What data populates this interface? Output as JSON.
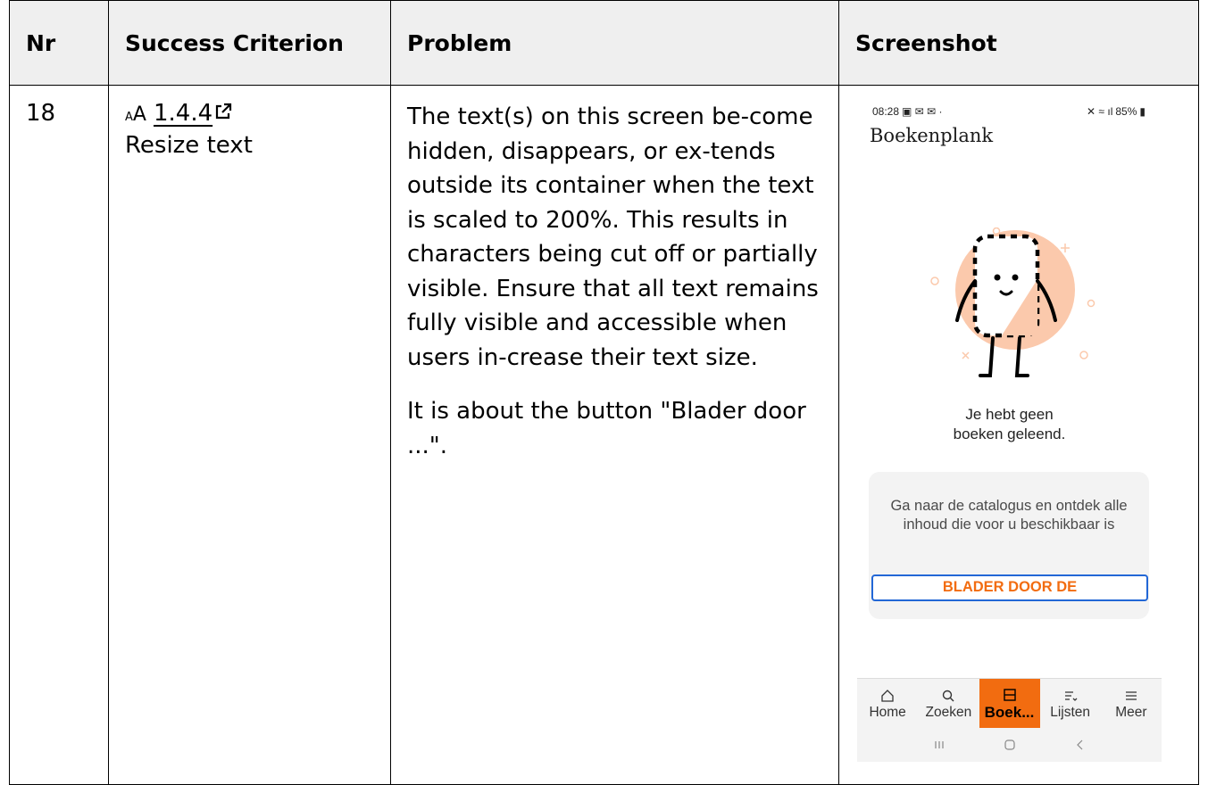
{
  "table": {
    "headers": {
      "nr": "Nr",
      "criterion": "Success Criterion",
      "problem": "Problem",
      "screenshot": "Screenshot"
    },
    "row": {
      "nr": "18",
      "criterion_code": "1.4.4",
      "criterion_name": "Resize text",
      "problem_paragraphs": [
        "The text(s) on this screen be-come hidden, disappears, or ex-tends outside its container when the text is scaled to 200%. This results in characters being cut off or partially visible. Ensure that all text remains fully visible and accessible when users in-crease their text size.",
        "It is about the button \"Blader door ...\"."
      ]
    }
  },
  "screenshot": {
    "status_time": "08:28",
    "status_battery": "85%",
    "app_title": "Boekenplank",
    "empty_line1": "Je hebt geen",
    "empty_line2": "boeken geleend.",
    "card_text": "Ga naar de catalogus en ontdek alle inhoud die voor u beschikbaar is",
    "card_button": "BLADER DOOR DE",
    "nav": [
      {
        "label": "Home",
        "icon": "home-icon"
      },
      {
        "label": "Zoeken",
        "icon": "search-icon"
      },
      {
        "label": "Boek...",
        "icon": "bookshelf-icon",
        "active": true
      },
      {
        "label": "Lijsten",
        "icon": "list-heart-icon"
      },
      {
        "label": "Meer",
        "icon": "menu-icon"
      }
    ],
    "colors": {
      "accent": "#f26c10",
      "focus_outline": "#2267d6",
      "illustration": "#fbc9ac"
    }
  }
}
